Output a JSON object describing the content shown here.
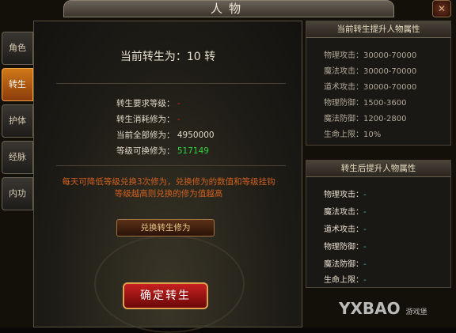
{
  "window": {
    "title": "人物",
    "close_icon": "close-icon"
  },
  "tabs": [
    {
      "label": "角色",
      "active": false
    },
    {
      "label": "转生",
      "active": true
    },
    {
      "label": "护体",
      "active": false
    },
    {
      "label": "经脉",
      "active": false
    },
    {
      "label": "内功",
      "active": false
    }
  ],
  "main": {
    "current_rebirth": "当前转生为：10  转",
    "rows": [
      {
        "label": "转生要求等级：",
        "value": "-"
      },
      {
        "label": "转生消耗修为：",
        "value": "-"
      },
      {
        "label": "当前全部修为：",
        "value": "4950000"
      },
      {
        "label": "等级可换修为：",
        "value": "517149"
      }
    ],
    "note_line1": "每天可降低等级兑换3次修为，兑换修为的数值和等级挂钩",
    "note_line2": "等级越高则兑换的修为值越高",
    "exchange_button": "兑换转生修为",
    "confirm_button": "确定转生"
  },
  "current_attrs": {
    "heading": "当前转生提升人物属性",
    "items": [
      {
        "label": "物理攻击：",
        "value": "30000-70000"
      },
      {
        "label": "魔法攻击：",
        "value": "30000-70000"
      },
      {
        "label": "道术攻击：",
        "value": "30000-70000"
      },
      {
        "label": "物理防御：",
        "value": "1500-3600"
      },
      {
        "label": "魔法防御：",
        "value": "1200-2800"
      },
      {
        "label": "生命上限：",
        "value": "10%"
      }
    ]
  },
  "after_attrs": {
    "heading": "转生后提升人物属性",
    "items": [
      {
        "label": "物理攻击：",
        "value": "-"
      },
      {
        "label": "魔法攻击：",
        "value": "-"
      },
      {
        "label": "道术攻击：",
        "value": "-"
      },
      {
        "label": "物理防御：",
        "value": "-"
      },
      {
        "label": "魔法防御：",
        "value": "-"
      },
      {
        "label": "生命上限：",
        "value": "-"
      }
    ]
  },
  "watermark": {
    "main": "YXBAO",
    "sub": "游戏堡"
  }
}
